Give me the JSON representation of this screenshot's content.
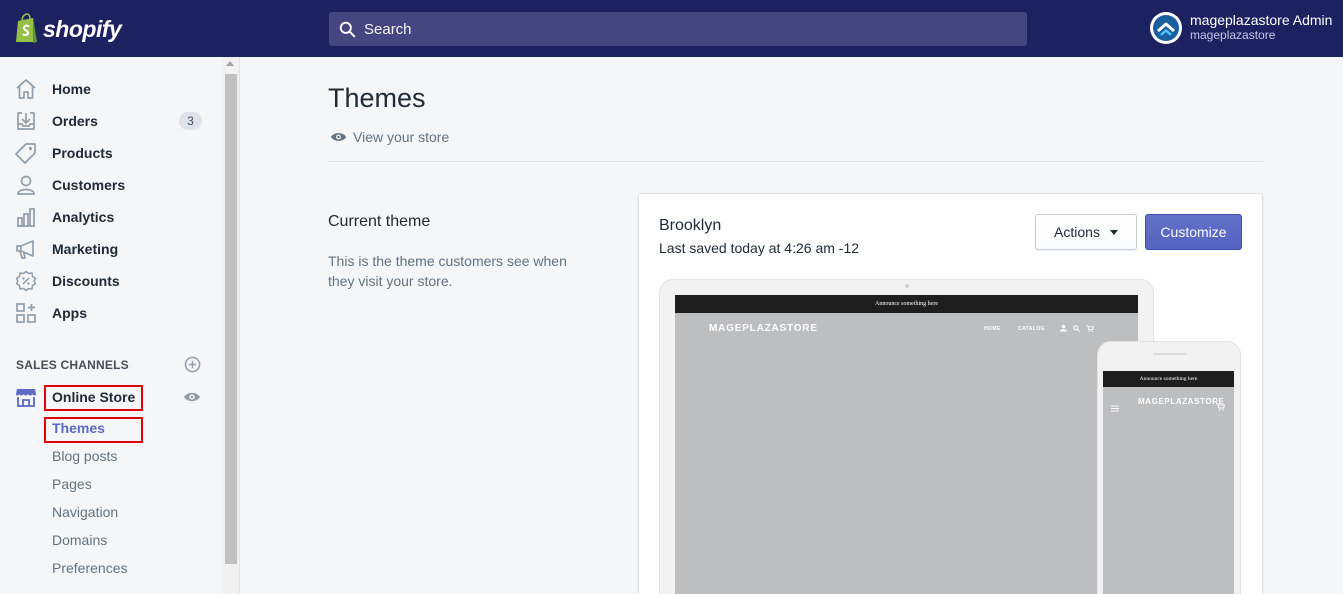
{
  "topbar": {
    "brand": "shopify",
    "search_placeholder": "Search",
    "account_name": "mageplazastore Admin",
    "account_store": "mageplazastore"
  },
  "sidebar": {
    "items": [
      {
        "label": "Home",
        "icon": "home-icon"
      },
      {
        "label": "Orders",
        "icon": "orders-icon",
        "badge": "3"
      },
      {
        "label": "Products",
        "icon": "tag-icon"
      },
      {
        "label": "Customers",
        "icon": "person-icon"
      },
      {
        "label": "Analytics",
        "icon": "bar-chart-icon"
      },
      {
        "label": "Marketing",
        "icon": "megaphone-icon"
      },
      {
        "label": "Discounts",
        "icon": "discount-icon"
      },
      {
        "label": "Apps",
        "icon": "apps-icon"
      }
    ],
    "sales_channels_heading": "SALES CHANNELS",
    "online_store": {
      "label": "Online Store",
      "icon": "store-icon",
      "sub_items": [
        "Themes",
        "Blog posts",
        "Pages",
        "Navigation",
        "Domains",
        "Preferences"
      ],
      "active_sub_item": "Themes"
    }
  },
  "main": {
    "title": "Themes",
    "view_store_link": "View your store",
    "current_theme": {
      "heading": "Current theme",
      "description": "This is the theme customers see when they visit your store."
    },
    "theme_card": {
      "name": "Brooklyn",
      "last_saved": "Last saved today at 4:26 am -12",
      "actions_label": "Actions",
      "customize_label": "Customize"
    },
    "preview": {
      "announcement": "Announce something here",
      "store_name": "MAGEPLAZASTORE",
      "nav_home": "HOME",
      "nav_catalog": "CATALOG"
    }
  },
  "colors": {
    "topbar": "#1c2260",
    "accent": "#5c6ac4",
    "highlight_box": "#e10000",
    "logo_green": "#95bf47"
  }
}
